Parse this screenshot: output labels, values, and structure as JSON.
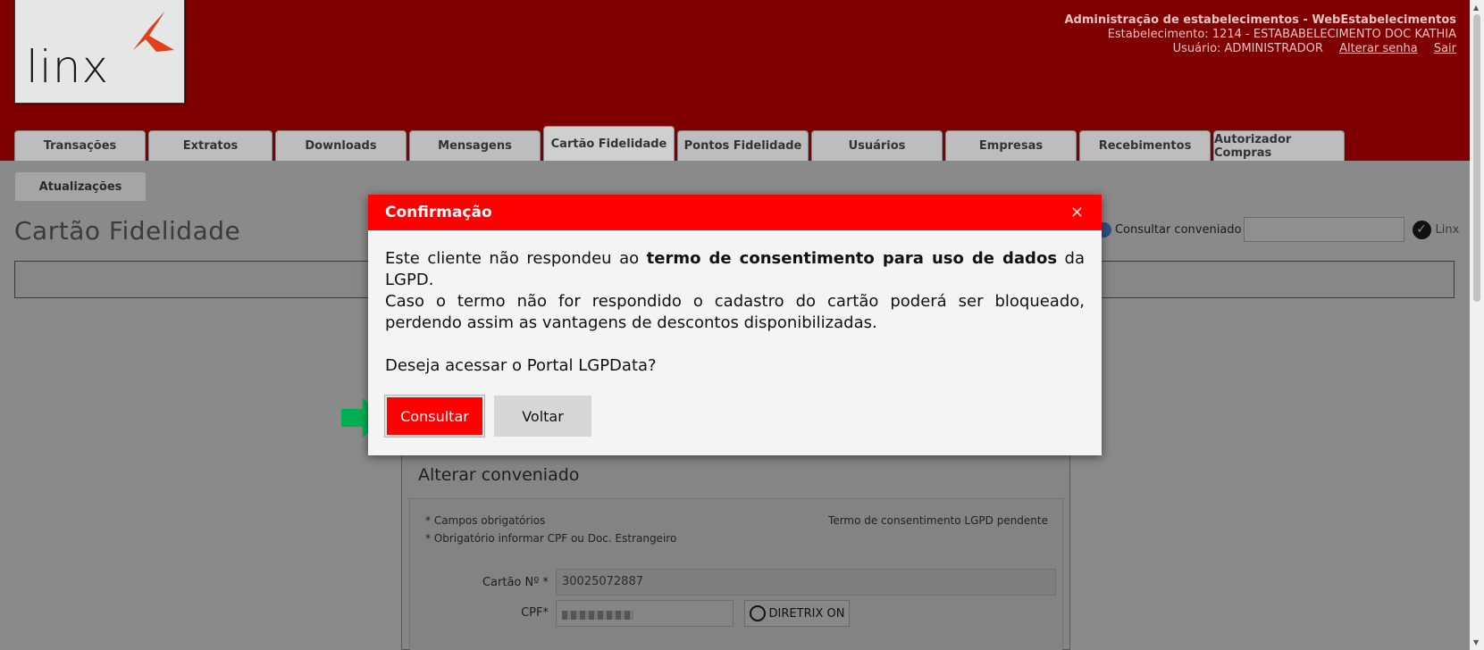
{
  "header": {
    "logo_text": "linx",
    "title": "Administração de estabelecimentos - WebEstabelecimentos",
    "establishment": "Estabelecimento: 1214 - ESTABABELECIMENTO DOC KATHIA",
    "user": "Usuário: ADMINISTRADOR",
    "change_password": "Alterar senha",
    "logout": "Sair"
  },
  "tabs": [
    {
      "label": "Transações"
    },
    {
      "label": "Extratos"
    },
    {
      "label": "Downloads"
    },
    {
      "label": "Mensagens"
    },
    {
      "label": "Cartão Fidelidade"
    },
    {
      "label": "Pontos Fidelidade"
    },
    {
      "label": "Usuários"
    },
    {
      "label": "Empresas"
    },
    {
      "label": "Recebimentos"
    },
    {
      "label": "Autorizador Compras"
    }
  ],
  "active_tab": "Cartão Fidelidade",
  "subtab": "Atualizações",
  "page_title": "Cartão Fidelidade",
  "consult": {
    "label": "Consultar conveniado",
    "value": "",
    "mini_logo": "Linx"
  },
  "form": {
    "title": "Alterar conveniado",
    "required_note": "* Campos obrigatórios",
    "cpf_note": "* Obrigatório informar CPF ou Doc. Estrangeiro",
    "lgpd_status": "Termo de consentimento LGPD pendente",
    "card_label": "Cartão Nº *",
    "card_value": "30025072887",
    "cpf_label": "CPF*",
    "diretrix_button": "DIRETRIX ON"
  },
  "modal": {
    "title": "Confirmação",
    "close": "✕",
    "text_before": "Este cliente não respondeu ao ",
    "text_bold": "termo de consentimento para uso de dados",
    "text_after": " da LGPD.",
    "text_2": "Caso o termo não for respondido o cadastro do cartão poderá ser bloqueado, perdendo assim as vantagens de descontos disponibilizadas.",
    "question": "Deseja acessar o Portal LGPData?",
    "confirm_button": "Consultar",
    "back_button": "Voltar"
  },
  "colors": {
    "header_bg": "#7f0000",
    "modal_head": "#ff0000",
    "arrow": "#00b050",
    "overlay_bg": "#8a8a8a"
  },
  "icons": [
    "linx-logo-icon",
    "info-icon",
    "check-circle-icon",
    "close-icon",
    "search-person-icon",
    "green-arrow-icon"
  ]
}
